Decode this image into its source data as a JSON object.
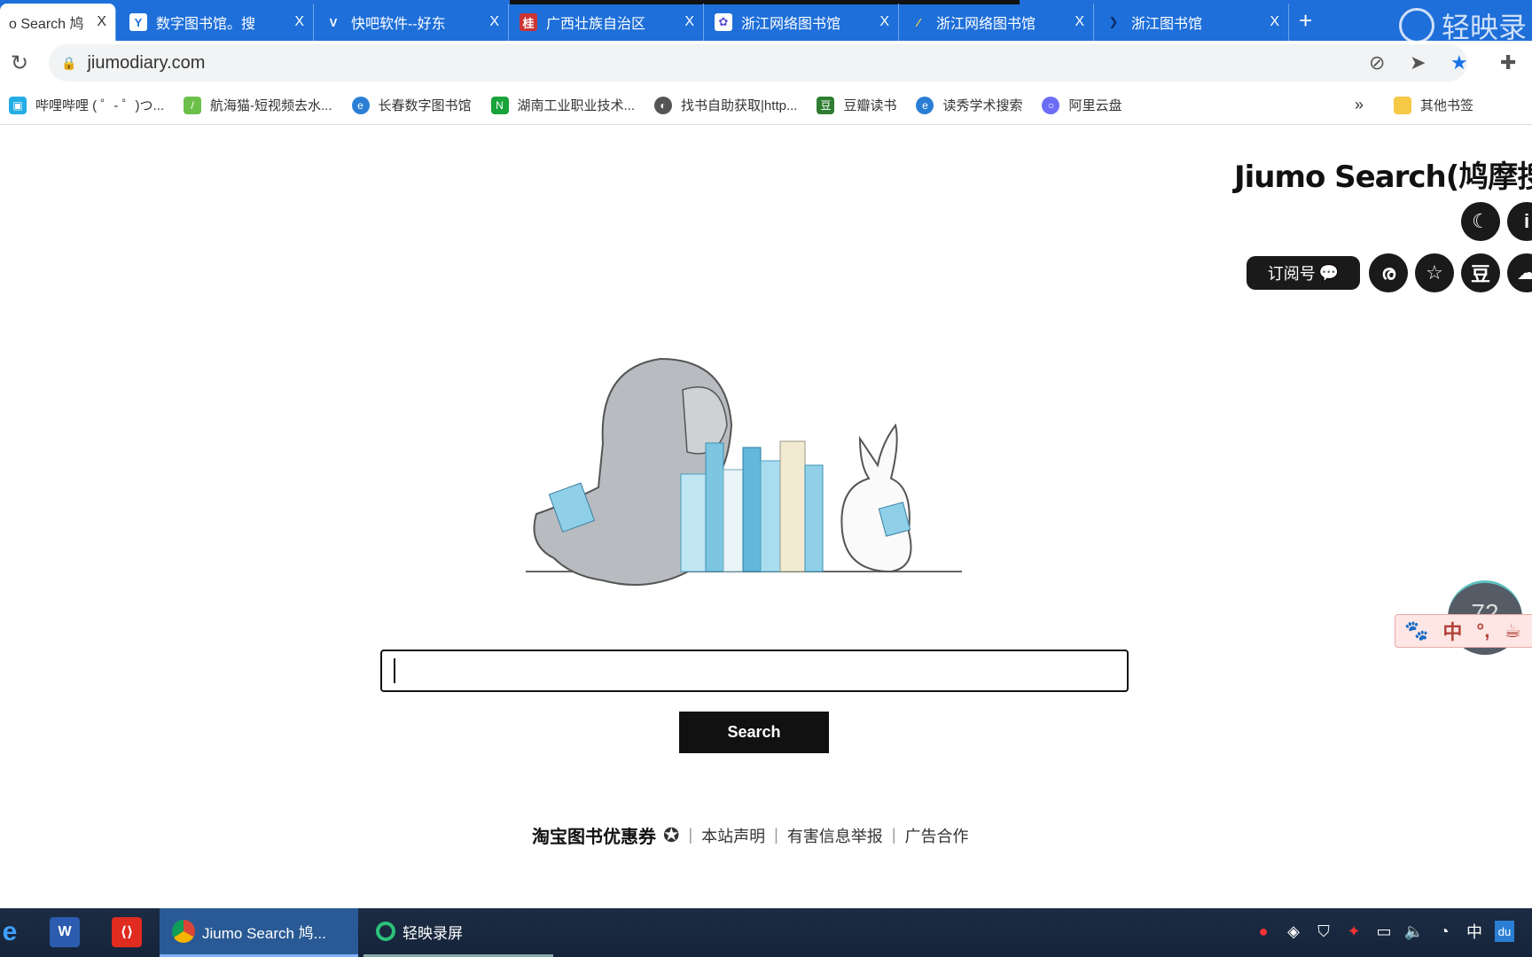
{
  "browser": {
    "tabs": [
      {
        "label": "o Search 鸠",
        "icon": "jiumo-icon",
        "active": true
      },
      {
        "label": "数字图书馆。搜",
        "icon": "y-icon"
      },
      {
        "label": "快吧软件--好东",
        "icon": "v-icon"
      },
      {
        "label": "广西壮族自治区",
        "icon": "library-icon"
      },
      {
        "label": "浙江网络图书馆",
        "icon": "paw-icon"
      },
      {
        "label": "浙江网络图书馆",
        "icon": "pen-icon"
      },
      {
        "label": "浙江图书馆",
        "icon": "bird-icon"
      }
    ],
    "close_glyph": "X",
    "new_tab": "+",
    "recorder_brand": "轻映录",
    "url": "jiumodiary.com",
    "bookmarks": [
      {
        "label": "哔哩哔哩 ( ゜- ゜)つ...",
        "color": "#23ade5"
      },
      {
        "label": "航海猫-短视频去水...",
        "color": "#6cc04a"
      },
      {
        "label": "长春数字图书馆",
        "color": "#2a7fd4"
      },
      {
        "label": "湖南工业职业技术...",
        "color": "#19a33b"
      },
      {
        "label": "找书自助获取|http...",
        "color": "#555555"
      },
      {
        "label": "豆瓣读书",
        "color": "#2e7d32"
      },
      {
        "label": "读秀学术搜索",
        "color": "#2a7fd4"
      },
      {
        "label": "阿里云盘",
        "color": "#6b6ef5"
      }
    ],
    "bookmarks_more": "»",
    "other_bookmarks": "其他书签"
  },
  "page": {
    "title": "Jiumo Search(鸠摩搜索",
    "icons_row1": [
      {
        "icon": "moon-icon",
        "glyph": "☾"
      },
      {
        "icon": "info-icon",
        "glyph": "i"
      }
    ],
    "subscribe_label": "订阅号",
    "icons_row2": [
      {
        "icon": "weibo-icon",
        "glyph": "ര"
      },
      {
        "icon": "zhihu-star-icon",
        "glyph": "☆"
      },
      {
        "icon": "douban-icon",
        "glyph": "豆"
      },
      {
        "icon": "cloud-icon",
        "glyph": "☁"
      }
    ],
    "search_value": "",
    "search_button": "Search",
    "footer": {
      "coupon": "淘宝图书优惠券",
      "links": [
        "本站声明",
        "有害信息举报",
        "广告合作"
      ],
      "separator": "|"
    }
  },
  "overlay": {
    "gauge_value": "72",
    "ime": [
      "中",
      "°,"
    ]
  },
  "taskbar": {
    "apps": [
      {
        "label": "Jiumo Search 鸠..."
      },
      {
        "label": "轻映录屏"
      }
    ],
    "tray_lang": "中"
  }
}
